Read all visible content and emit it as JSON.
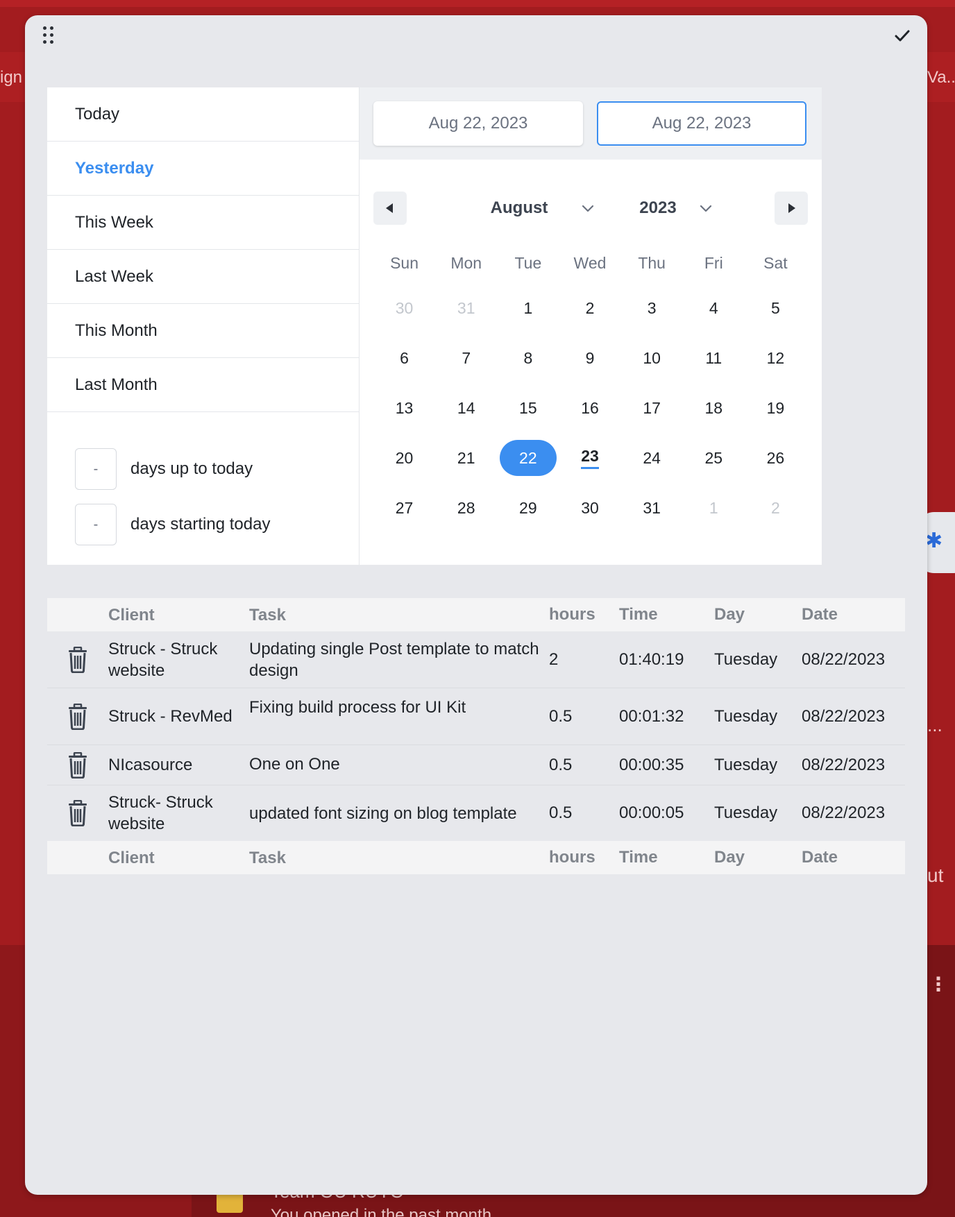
{
  "background": {
    "left_text": "ign",
    "right_text": "Va...",
    "ellipsis": "...",
    "right_text_2": "ut",
    "note_title": "Team OU RUYO",
    "note_subtitle": "You opened in the past month"
  },
  "presets": [
    {
      "label": "Today"
    },
    {
      "label": "Yesterday",
      "active": true
    },
    {
      "label": "This Week"
    },
    {
      "label": "Last Week"
    },
    {
      "label": "This Month"
    },
    {
      "label": "Last Month"
    }
  ],
  "custom_range": {
    "up_to_today": {
      "value": "-",
      "label": "days up to today"
    },
    "starting_today": {
      "value": "-",
      "label": "days starting today"
    }
  },
  "range": {
    "start": "Aug 22, 2023",
    "end": "Aug 22, 2023"
  },
  "calendar": {
    "month": "August",
    "year": "2023",
    "weekdays": [
      "Sun",
      "Mon",
      "Tue",
      "Wed",
      "Thu",
      "Fri",
      "Sat"
    ],
    "days": [
      {
        "d": "30",
        "muted": true
      },
      {
        "d": "31",
        "muted": true
      },
      {
        "d": "1"
      },
      {
        "d": "2"
      },
      {
        "d": "3"
      },
      {
        "d": "4"
      },
      {
        "d": "5"
      },
      {
        "d": "6"
      },
      {
        "d": "7"
      },
      {
        "d": "8"
      },
      {
        "d": "9"
      },
      {
        "d": "10"
      },
      {
        "d": "11"
      },
      {
        "d": "12"
      },
      {
        "d": "13"
      },
      {
        "d": "14"
      },
      {
        "d": "15"
      },
      {
        "d": "16"
      },
      {
        "d": "17"
      },
      {
        "d": "18"
      },
      {
        "d": "19"
      },
      {
        "d": "20"
      },
      {
        "d": "21"
      },
      {
        "d": "22",
        "selected": true
      },
      {
        "d": "23",
        "today": true
      },
      {
        "d": "24"
      },
      {
        "d": "25"
      },
      {
        "d": "26"
      },
      {
        "d": "27"
      },
      {
        "d": "28"
      },
      {
        "d": "29"
      },
      {
        "d": "30"
      },
      {
        "d": "31"
      },
      {
        "d": "1",
        "muted": true
      },
      {
        "d": "2",
        "muted": true
      }
    ]
  },
  "table": {
    "columns": [
      "Client",
      "Task",
      "hours",
      "Time",
      "Day",
      "Date"
    ],
    "rows": [
      {
        "client": "Struck - Struck website",
        "task": "Updating single Post template to match design",
        "hours": "2",
        "time": "01:40:19",
        "day": "Tuesday",
        "date": "08/22/2023"
      },
      {
        "client": "Struck - RevMed",
        "task": "Fixing build process for UI Kit",
        "hours": "0.5",
        "time": "00:01:32",
        "day": "Tuesday",
        "date": "08/22/2023"
      },
      {
        "client": "NIcasource",
        "task": "One on One",
        "hours": "0.5",
        "time": "00:00:35",
        "day": "Tuesday",
        "date": "08/22/2023"
      },
      {
        "client": "Struck- Struck website",
        "task": "updated font sizing on blog template",
        "hours": "0.5",
        "time": "00:00:05",
        "day": "Tuesday",
        "date": "08/22/2023"
      }
    ]
  },
  "colors": {
    "accent": "#3b8ef0",
    "page_bg": "#a31c1f",
    "modal_bg": "#e7e8ec"
  },
  "icons": {
    "drag": "drag-handle-icon",
    "confirm": "checkmark-icon",
    "prev": "triangle-left-icon",
    "next": "triangle-right-icon",
    "dropdown": "chevron-down-icon",
    "delete": "trash-icon"
  }
}
